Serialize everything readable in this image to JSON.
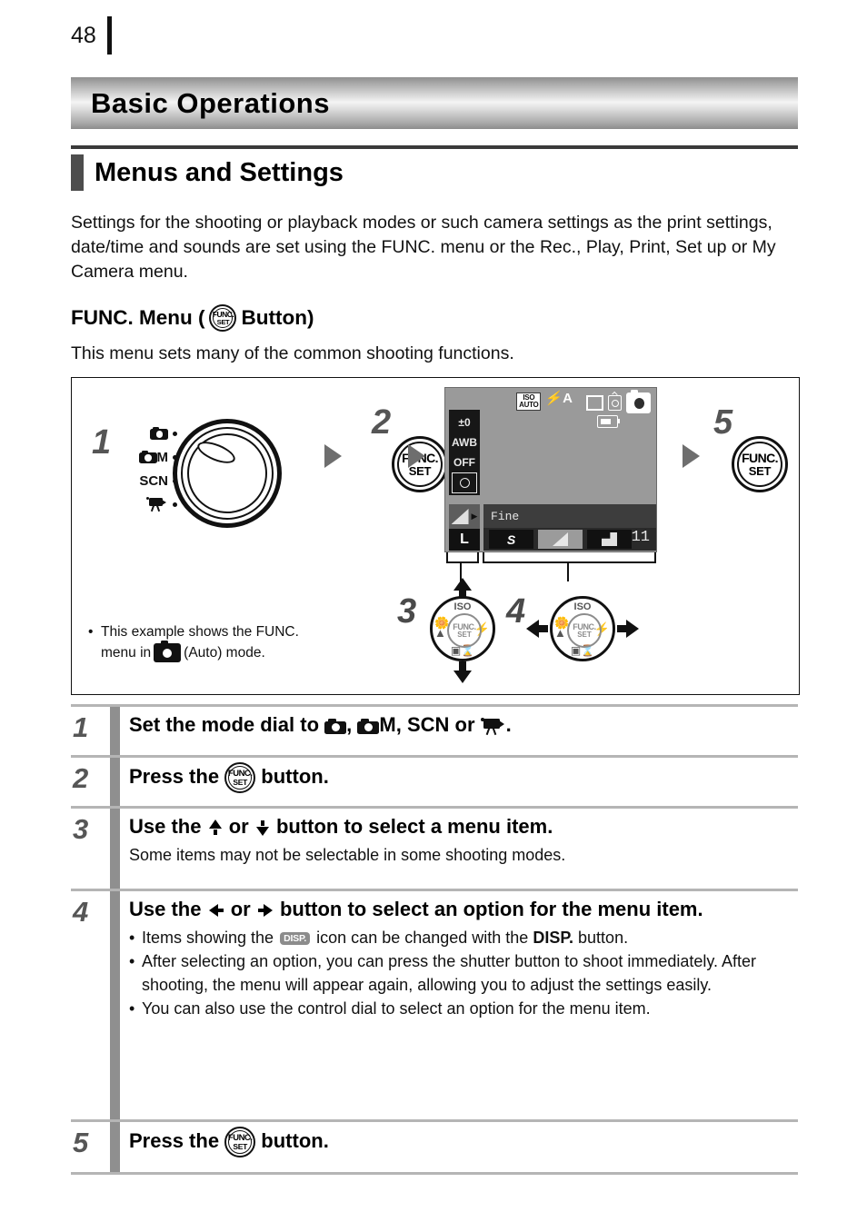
{
  "page": {
    "number": "48"
  },
  "banner": {
    "title": "Basic Operations"
  },
  "section": {
    "title": "Menus and Settings"
  },
  "intro": {
    "text": "Settings for the shooting or playback modes or such camera settings as the print settings, date/time and sounds are set using the FUNC. menu or the Rec., Play, Print, Set up or My Camera menu."
  },
  "subsection": {
    "title_before": "FUNC. Menu (",
    "title_after": " Button)",
    "description": "This menu sets many of the common shooting functions.",
    "button_icon": "func-set-button-icon"
  },
  "figure": {
    "step1": {
      "number": "1",
      "dial_labels": [
        {
          "icon": "camera-auto-icon",
          "text": ""
        },
        {
          "icon": "camera-manual-icon",
          "text": "M"
        },
        {
          "icon": "",
          "text": "SCN"
        },
        {
          "icon": "movie-camera-icon",
          "text": ""
        }
      ]
    },
    "step2": {
      "number": "2",
      "button_top": "FUNC.",
      "button_bottom": "SET"
    },
    "step3": {
      "number": "3"
    },
    "step4": {
      "number": "4"
    },
    "step5": {
      "number": "5",
      "button_top": "FUNC.",
      "button_bottom": "SET"
    },
    "lcd": {
      "iso_label_top": "ISO",
      "iso_label_bottom": "AUTO",
      "flash_label": "A",
      "left_column": [
        {
          "name": "exposure-compensation",
          "label": "±0"
        },
        {
          "name": "white-balance",
          "label": "AWB"
        },
        {
          "name": "my-colors",
          "label": "OFF"
        },
        {
          "name": "metering-mode",
          "label": ""
        }
      ],
      "selected_item": "compression-quality",
      "resolution_label": "L",
      "quality_label": "Fine",
      "options": [
        {
          "name": "superfine",
          "label": "S",
          "selected": false
        },
        {
          "name": "fine",
          "label": "",
          "selected": true
        },
        {
          "name": "normal",
          "label": "",
          "selected": false
        }
      ],
      "shots_remaining": "11"
    },
    "control_dial": {
      "top_label": "ISO",
      "center_top": "FUNC.",
      "center_bottom": "SET",
      "left_label": "macro-landscape-icon",
      "right_label": "flash-icon",
      "bottom_label": "drive-timer-icon"
    },
    "note": {
      "line1": "This example shows the FUNC.",
      "line2_before": "menu in",
      "line2_after": "(Auto) mode.",
      "mode_icon": "auto-mode-icon"
    }
  },
  "steps": [
    {
      "number": "1",
      "title_parts": [
        "Set the mode dial to ",
        ", ",
        "M, ",
        "SCN",
        " or ",
        "."
      ],
      "title_plain": "Set the mode dial to , M, SCN or .",
      "sub": "",
      "bullets": []
    },
    {
      "number": "2",
      "title_before": "Press the ",
      "title_after": " button.",
      "sub": "",
      "bullets": []
    },
    {
      "number": "3",
      "title_before": "Use the ",
      "title_mid": " or ",
      "title_after": " button to select a menu item.",
      "sub": "Some items may not be selectable in some shooting modes.",
      "bullets": []
    },
    {
      "number": "4",
      "title_before": "Use the ",
      "title_mid": " or ",
      "title_after": " button to select an option for the menu item.",
      "bullets": [
        {
          "before": "Items showing the ",
          "chip": "DISP.",
          "mid": " icon can be changed with the ",
          "bold": "DISP.",
          "after": " button."
        },
        {
          "text": "After selecting an option, you can press the shutter button to shoot immediately. After shooting, the menu will appear again, allowing you to adjust the settings easily."
        },
        {
          "text": "You can also use the control dial to select an option for the menu item."
        }
      ]
    },
    {
      "number": "5",
      "title_before": "Press the ",
      "title_after": " button.",
      "sub": "",
      "bullets": []
    }
  ]
}
